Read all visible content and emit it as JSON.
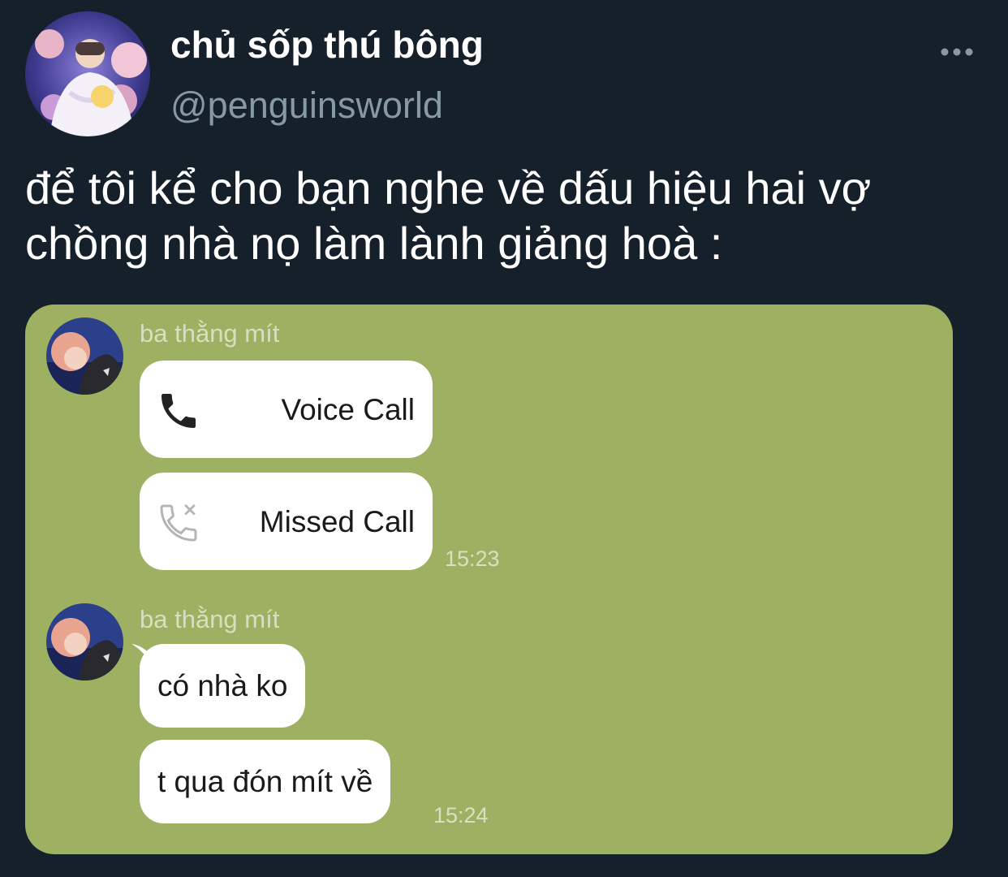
{
  "tweet": {
    "display_name": "chủ sốp thú bông",
    "handle": "@penguinsworld",
    "text": "để tôi kể cho bạn nghe về dấu hiệu hai vợ chồng nhà nọ làm lành giảng hoà :"
  },
  "chat": {
    "background_color": "#9eb163",
    "groups": [
      {
        "sender": "ba thằng mít",
        "messages": [
          {
            "type": "call",
            "icon": "phone-icon",
            "label": "Voice Call"
          },
          {
            "type": "call",
            "icon": "missed-call-icon",
            "label": "Missed Call"
          }
        ],
        "time": "15:23"
      },
      {
        "sender": "ba thằng mít",
        "messages": [
          {
            "type": "text",
            "label": "có nhà ko"
          },
          {
            "type": "text",
            "label": "t qua đón mít về"
          }
        ],
        "time": "15:24"
      }
    ]
  }
}
